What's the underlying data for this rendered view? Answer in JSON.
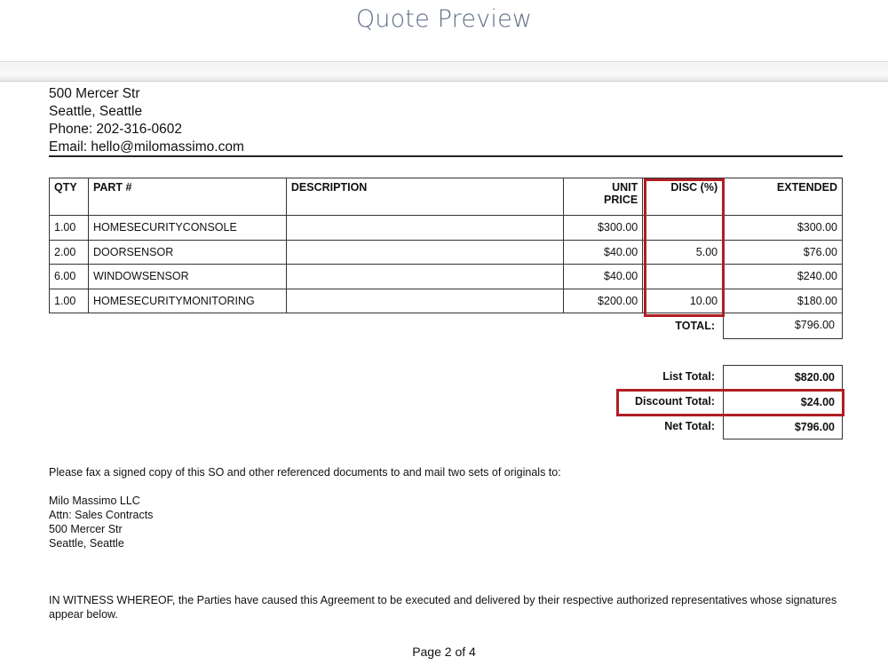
{
  "header": {
    "title": "Quote Preview"
  },
  "company": {
    "street": "500 Mercer Str",
    "city": "Seattle, Seattle",
    "phone": "Phone: 202-316-0602",
    "email": "Email: hello@milomassimo.com"
  },
  "table": {
    "headers": {
      "qty": "QTY",
      "part": "PART #",
      "desc": "DESCRIPTION",
      "unit_line1": "UNIT",
      "unit_line2": "PRICE",
      "disc": "DISC (%)",
      "ext": "EXTENDED"
    },
    "rows": [
      {
        "qty": "1.00",
        "part": "HOMESECURITYCONSOLE",
        "desc": "",
        "unit": "$300.00",
        "disc": "",
        "ext": "$300.00"
      },
      {
        "qty": "2.00",
        "part": "DOORSENSOR",
        "desc": "",
        "unit": "$40.00",
        "disc": "5.00",
        "ext": "$76.00"
      },
      {
        "qty": "6.00",
        "part": "WINDOWSENSOR",
        "desc": "",
        "unit": "$40.00",
        "disc": "",
        "ext": "$240.00"
      },
      {
        "qty": "1.00",
        "part": "HOMESECURITYMONITORING",
        "desc": "",
        "unit": "$200.00",
        "disc": "10.00",
        "ext": "$180.00"
      }
    ],
    "total_label": "TOTAL:",
    "total_value": "$796.00"
  },
  "summary": {
    "list_label": "List Total:",
    "list_value": "$820.00",
    "discount_label": "Discount Total:",
    "discount_value": "$24.00",
    "net_label": "Net Total:",
    "net_value": "$796.00"
  },
  "notes": {
    "fax": "Please fax a signed copy of this SO and other referenced documents to and mail two sets of originals to:",
    "mail": [
      "Milo Massimo LLC",
      "Attn: Sales Contracts",
      "500 Mercer Str",
      "Seattle, Seattle"
    ],
    "witness": "IN WITNESS WHEREOF, the Parties have caused this Agreement to be executed and delivered by their respective authorized representatives whose signatures appear below."
  },
  "footer": {
    "page": "Page 2 of 4"
  },
  "colors": {
    "highlight": "#b01e23",
    "title": "#5f6e86"
  }
}
